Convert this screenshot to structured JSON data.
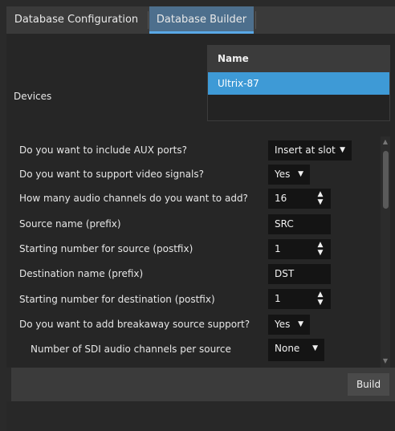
{
  "tabs": [
    {
      "label": "Database Configuration",
      "active": false
    },
    {
      "label": "Database Builder",
      "active": true
    }
  ],
  "devices": {
    "label": "Devices",
    "column_header": "Name",
    "items": [
      {
        "name": "Ultrix-87",
        "selected": true
      }
    ]
  },
  "form": {
    "aux_ports": {
      "question": "Do you want to include AUX ports?",
      "value": "Insert at slot"
    },
    "video_signals": {
      "question": "Do you want to support video signals?",
      "value": "Yes"
    },
    "audio_channels": {
      "question": "How many audio channels do you want to add?",
      "value": "16"
    },
    "source_prefix": {
      "question": "Source name (prefix)",
      "value": "SRC"
    },
    "source_postfix": {
      "question": "Starting number for source (postfix)",
      "value": "1"
    },
    "dest_prefix": {
      "question": "Destination name (prefix)",
      "value": "DST"
    },
    "dest_postfix": {
      "question": "Starting number for destination (postfix)",
      "value": "1"
    },
    "breakaway": {
      "question": "Do you want to add breakaway source support?",
      "value": "Yes"
    },
    "sdi_audio": {
      "question": "Number of SDI audio channels per source",
      "value": "None"
    }
  },
  "icons": {
    "dropdown": "▼",
    "spin_up": "▲",
    "spin_down": "▼",
    "scroll_up": "▲",
    "scroll_down": "▼"
  },
  "footer": {
    "build_label": "Build"
  },
  "colors": {
    "accent": "#3e9ad6",
    "active_tab": "#4d6f8d",
    "tab_underline": "#5aa8e6"
  }
}
